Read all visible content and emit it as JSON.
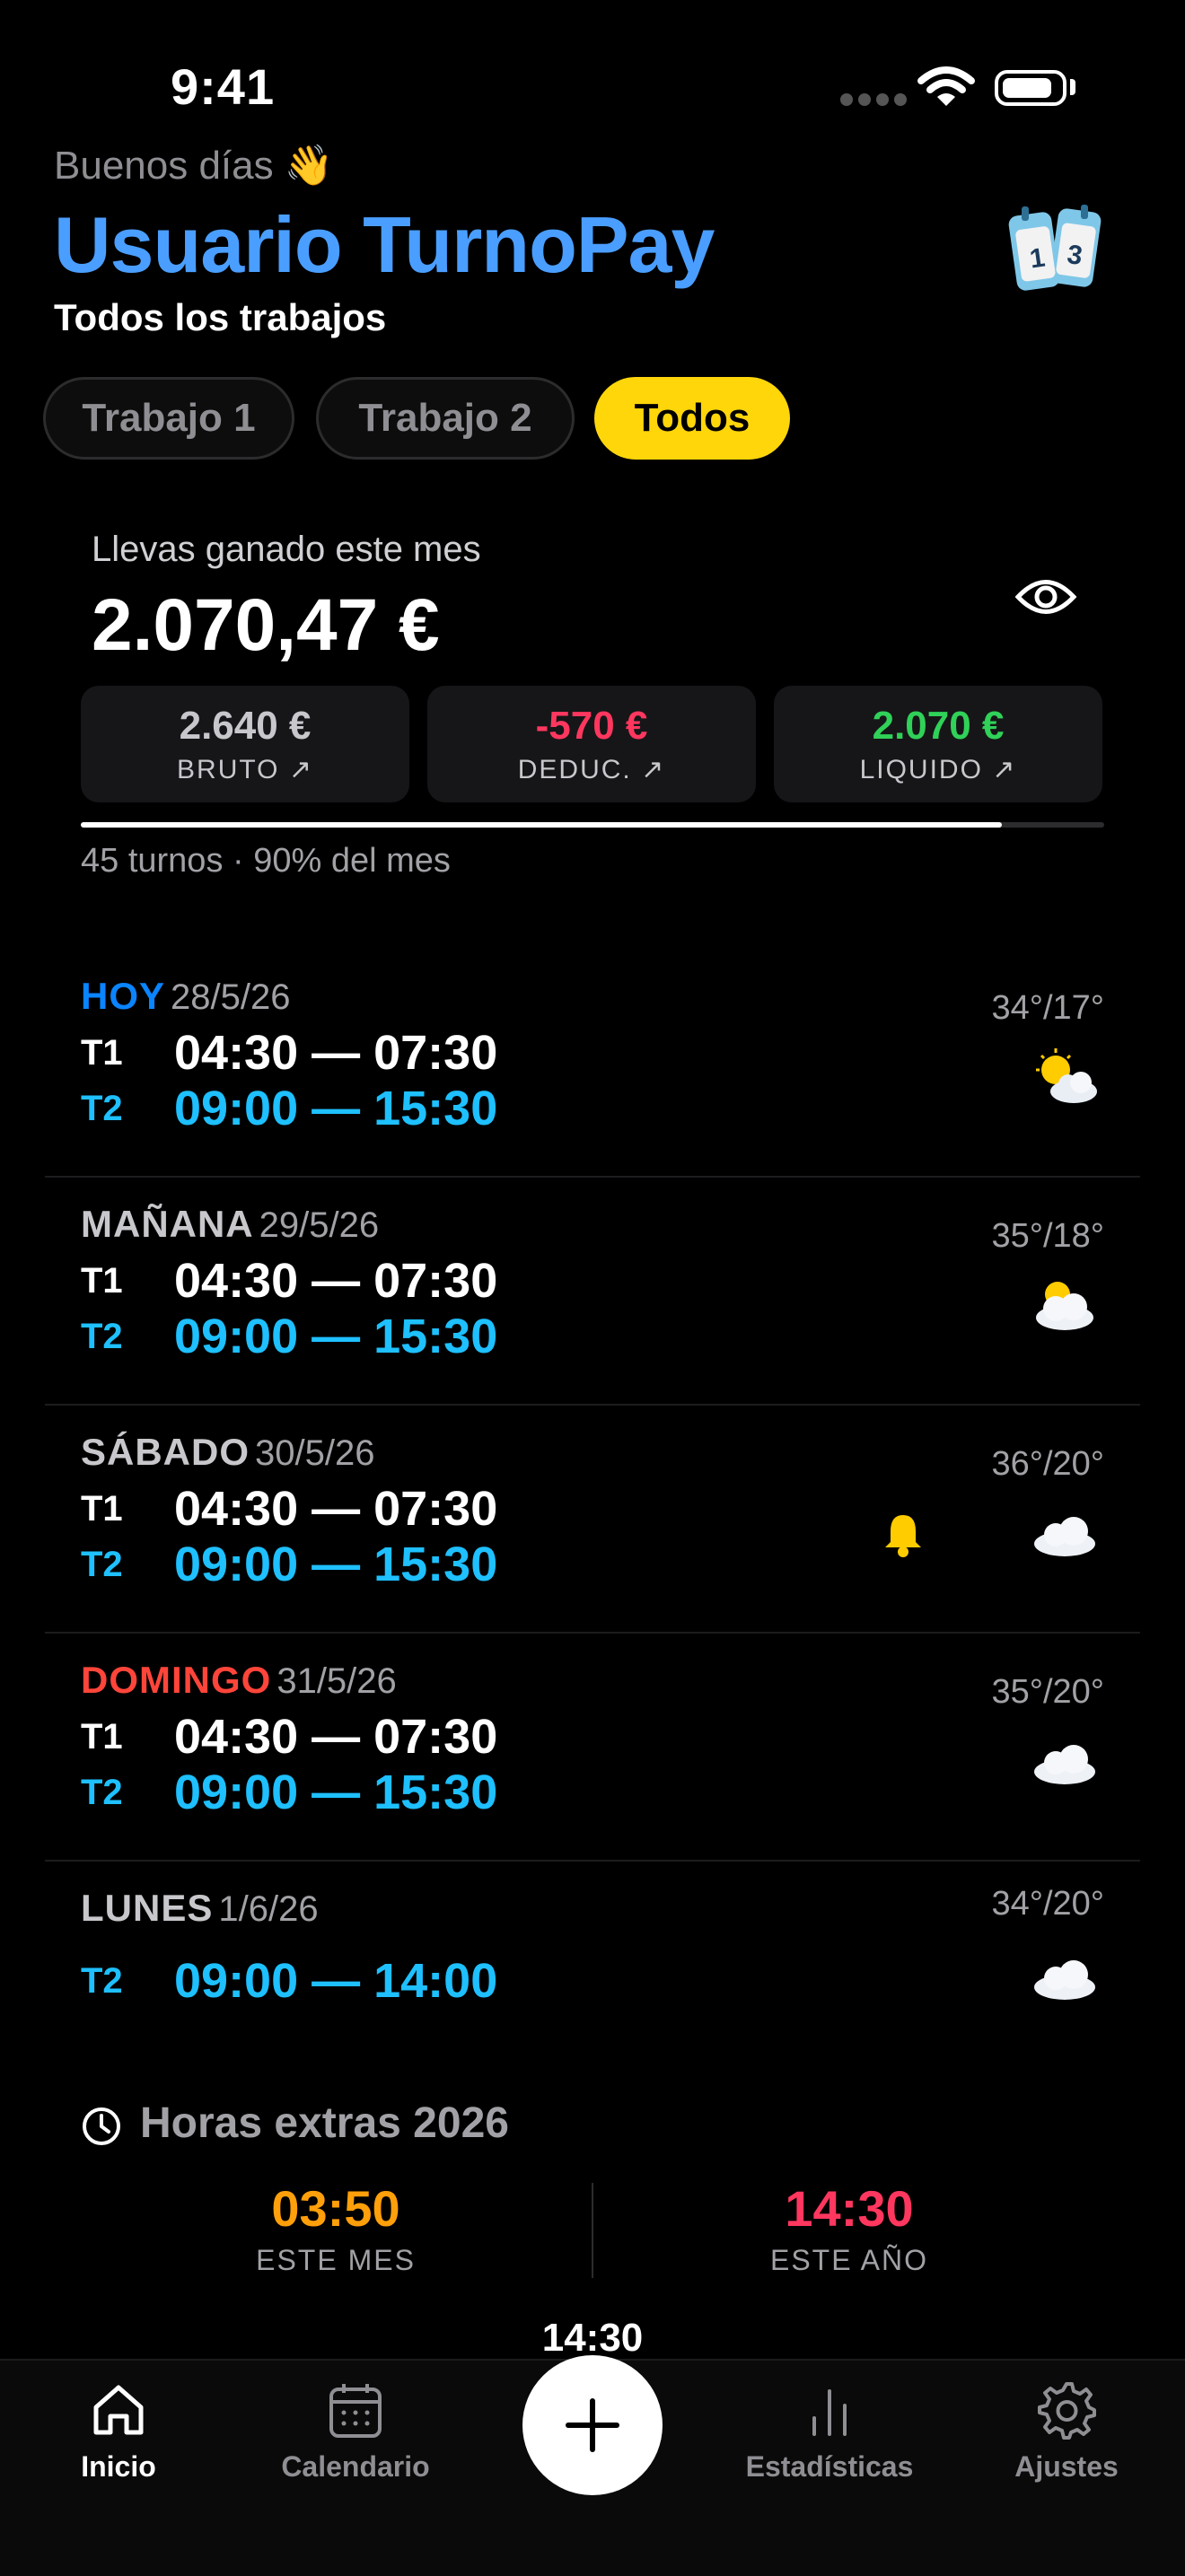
{
  "status_bar": {
    "time": "9:41"
  },
  "header": {
    "greeting": "Buenos días 👋",
    "user_name": "Usuario TurnoPay",
    "subtitle": "Todos los trabajos"
  },
  "tabs": [
    {
      "label": "Trabajo 1",
      "active": false
    },
    {
      "label": "Trabajo 2",
      "active": false
    },
    {
      "label": "Todos",
      "active": true
    }
  ],
  "earnings": {
    "label": "Llevas ganado este mes",
    "amount": "2.070,47 €",
    "cards": [
      {
        "value": "2.640 €",
        "label": "BRUTO ↗",
        "color": "#c7c7cc"
      },
      {
        "value": "-570 €",
        "label": "DEDUC. ↗",
        "color": "#ff375f"
      },
      {
        "value": "2.070 €",
        "label": "LIQUIDO ↗",
        "color": "#30d158"
      }
    ],
    "progress_fraction": 0.9,
    "progress_text": "45 turnos · 90% del mes"
  },
  "days": [
    {
      "name": "HOY",
      "name_color": "#0a84ff",
      "date": "28/5/26",
      "temp": "34°/17°",
      "weather": "sun-cloud-icon",
      "shifts": [
        {
          "id": "T1",
          "time": "04:30 — 07:30"
        },
        {
          "id": "T2",
          "time": "09:00 — 15:30"
        }
      ]
    },
    {
      "name": "MAÑANA",
      "name_color": "#c7c7cc",
      "date": "29/5/26",
      "temp": "35°/18°",
      "weather": "sun-behind-cloud-icon",
      "shifts": [
        {
          "id": "T1",
          "time": "04:30 — 07:30"
        },
        {
          "id": "T2",
          "time": "09:00 — 15:30"
        }
      ]
    },
    {
      "name": "SÁBADO",
      "name_color": "#c7c7cc",
      "date": "30/5/26",
      "temp": "36°/20°",
      "weather": "cloud-icon",
      "bell": true,
      "shifts": [
        {
          "id": "T1",
          "time": "04:30 — 07:30"
        },
        {
          "id": "T2",
          "time": "09:00 — 15:30"
        }
      ]
    },
    {
      "name": "DOMINGO",
      "name_color": "#ff453a",
      "date": "31/5/26",
      "temp": "35°/20°",
      "weather": "cloud-icon",
      "shifts": [
        {
          "id": "T1",
          "time": "04:30 — 07:30"
        },
        {
          "id": "T2",
          "time": "09:00 — 15:30"
        }
      ]
    },
    {
      "name": "LUNES",
      "name_color": "#c7c7cc",
      "date": "1/6/26",
      "temp": "34°/20°",
      "weather": "cloud-icon",
      "shifts": [
        {
          "id": "T2",
          "time": "09:00 — 14:00"
        }
      ]
    }
  ],
  "overtime": {
    "title": "Horas extras 2026",
    "month_value": "03:50",
    "month_label": "ESTE MES",
    "month_color": "#ff9f0a",
    "year_value": "14:30",
    "year_label": "ESTE AÑO",
    "year_color": "#ff375f"
  },
  "timer_label": "14:30",
  "nav": {
    "home": "Inicio",
    "calendar": "Calendario",
    "stats": "Estadísticas",
    "settings": "Ajustes"
  }
}
